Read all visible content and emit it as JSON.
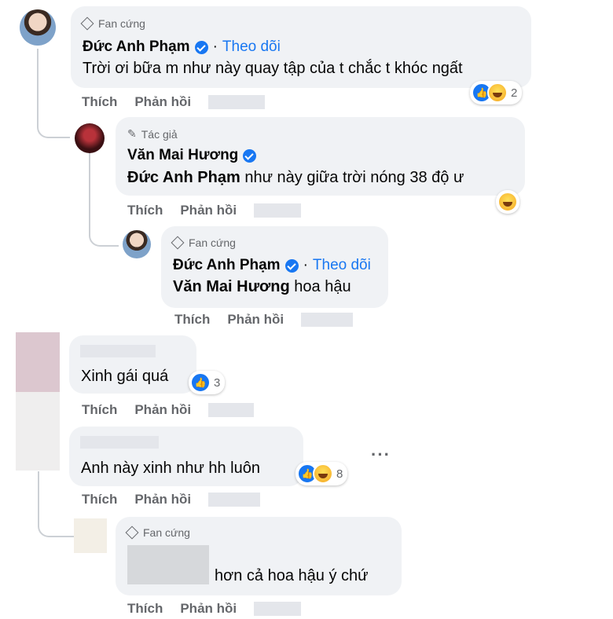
{
  "labels": {
    "like": "Thích",
    "reply": "Phản hồi",
    "follow": "Theo dõi",
    "dot": "·",
    "more": "···"
  },
  "comments": [
    {
      "badge": "Fan cứng",
      "author": "Đức Anh Phạm",
      "text": "Trời ơi bữa m như này quay tập của t chắc t khóc ngất",
      "reaction_count": "2"
    },
    {
      "badge": "Tác giả",
      "author": "Văn Mai Hương",
      "mention": "Đức Anh Phạm",
      "text": " như này giữa trời nóng 38 độ ư"
    },
    {
      "badge": "Fan cứng",
      "author": "Đức Anh Phạm",
      "mention": "Văn Mai Hương",
      "text": " hoa hậu"
    },
    {
      "text": "Xinh gái quá",
      "reaction_count": "3"
    },
    {
      "text": "Anh này xinh như hh luôn",
      "reaction_count": "8"
    },
    {
      "badge": "Fan cứng",
      "text": "hơn cả hoa hậu ý chứ"
    }
  ],
  "colors": {
    "bubble": "#f0f2f5",
    "link_blue": "#1877f2",
    "meta_gray": "#65676b",
    "text": "#050505"
  },
  "icons": [
    "diamond-icon",
    "pencil-icon",
    "verified-icon",
    "like-reaction-icon",
    "haha-reaction-icon",
    "more-options-icon"
  ]
}
